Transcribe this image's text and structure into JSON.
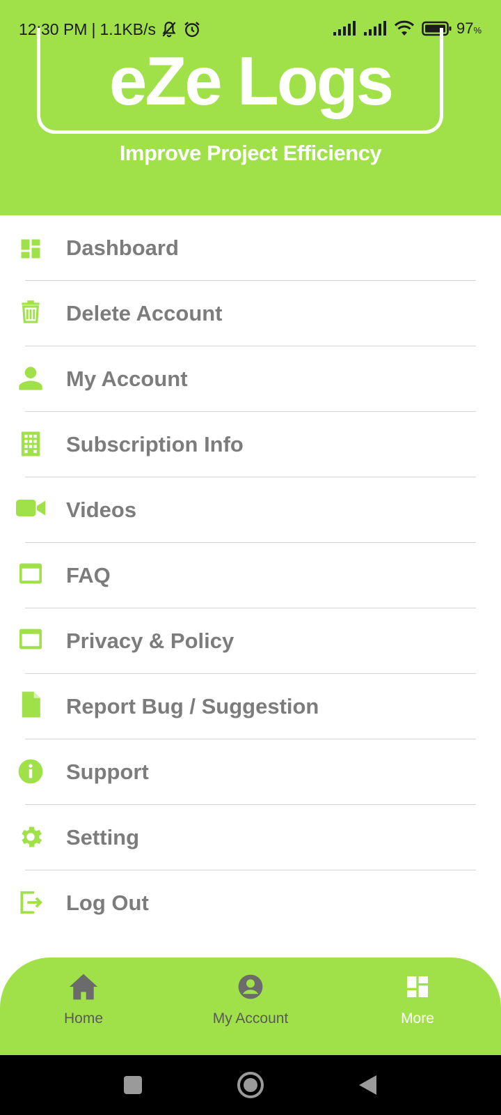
{
  "status_bar": {
    "time": "12:30 PM",
    "separator": "|",
    "speed": "1.1KB/s",
    "battery": "97",
    "battery_unit": "%"
  },
  "header": {
    "logo": "eZe Logs",
    "tagline": "Improve Project Efficiency"
  },
  "menu": {
    "items": [
      {
        "label": "Dashboard",
        "icon": "dashboard-icon"
      },
      {
        "label": "Delete Account",
        "icon": "trash-icon"
      },
      {
        "label": "My Account",
        "icon": "person-icon"
      },
      {
        "label": "Subscription Info",
        "icon": "building-icon"
      },
      {
        "label": "Videos",
        "icon": "video-camera-icon"
      },
      {
        "label": "FAQ",
        "icon": "web-window-icon"
      },
      {
        "label": "Privacy & Policy",
        "icon": "web-window-icon"
      },
      {
        "label": "Report Bug / Suggestion",
        "icon": "document-icon"
      },
      {
        "label": "Support",
        "icon": "info-icon"
      },
      {
        "label": "Setting",
        "icon": "gear-icon"
      },
      {
        "label": "Log Out",
        "icon": "logout-icon"
      }
    ]
  },
  "bottom_nav": {
    "items": [
      {
        "label": "Home",
        "icon": "home-icon",
        "active": false
      },
      {
        "label": "My Account",
        "icon": "account-circle-icon",
        "active": false
      },
      {
        "label": "More",
        "icon": "dashboard-icon",
        "active": true
      }
    ]
  },
  "colors": {
    "accent": "#a0e149",
    "menu_text": "#7c7c7c",
    "inactive_nav": "#5a5a5a",
    "active_nav": "#ffffff"
  }
}
